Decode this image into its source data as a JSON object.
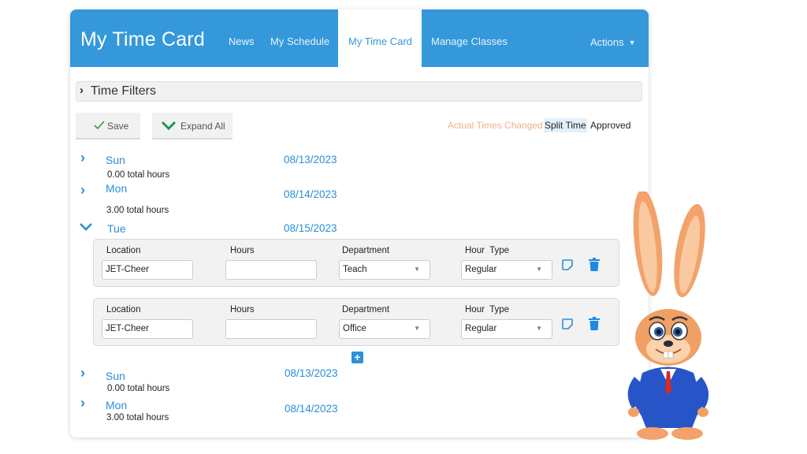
{
  "header": {
    "app_title": "My Time Card",
    "nav": [
      {
        "label": "News"
      },
      {
        "label": "My Schedule"
      },
      {
        "label": "My Time Card",
        "active": true
      },
      {
        "label": "Manage Classes"
      }
    ],
    "actions_label": "Actions",
    "brand_color": "#3498db"
  },
  "filters": {
    "label": "Time Filters"
  },
  "toolbar": {
    "save_label": "Save",
    "expand_all_label": "Expand All"
  },
  "legend": {
    "actual_times_changed": "Actual Times Changed",
    "split_time": "Split Time",
    "approved": "Approved"
  },
  "days": [
    {
      "name": "Sun",
      "date": "08/13/2023",
      "total": "0.00 total hours",
      "expanded": false
    },
    {
      "name": "Mon",
      "date": "08/14/2023",
      "total": "3.00 total hours",
      "expanded": false
    },
    {
      "name": "Tue",
      "date": "08/15/2023",
      "expanded": true,
      "entries": [
        {
          "location_label": "Location",
          "location": "JET-Cheer",
          "hours_label": "Hours",
          "hours": "",
          "department_label": "Department",
          "department": "Teach",
          "hour_type_label": "Hour  Type",
          "hour_type": "Regular"
        },
        {
          "location_label": "Location",
          "location": "JET-Cheer",
          "hours_label": "Hours",
          "hours": "",
          "department_label": "Department",
          "department": "Office",
          "hour_type_label": "Hour  Type",
          "hour_type": "Regular"
        }
      ]
    },
    {
      "name": "Sun",
      "date": "08/13/2023",
      "total": "0.00 total hours",
      "expanded": false
    },
    {
      "name": "Mon",
      "date": "08/14/2023",
      "total": "3.00 total hours",
      "expanded": false
    }
  ],
  "icons": {
    "chevron_right": "›",
    "dropdown_caret": "▼",
    "add": "+"
  }
}
